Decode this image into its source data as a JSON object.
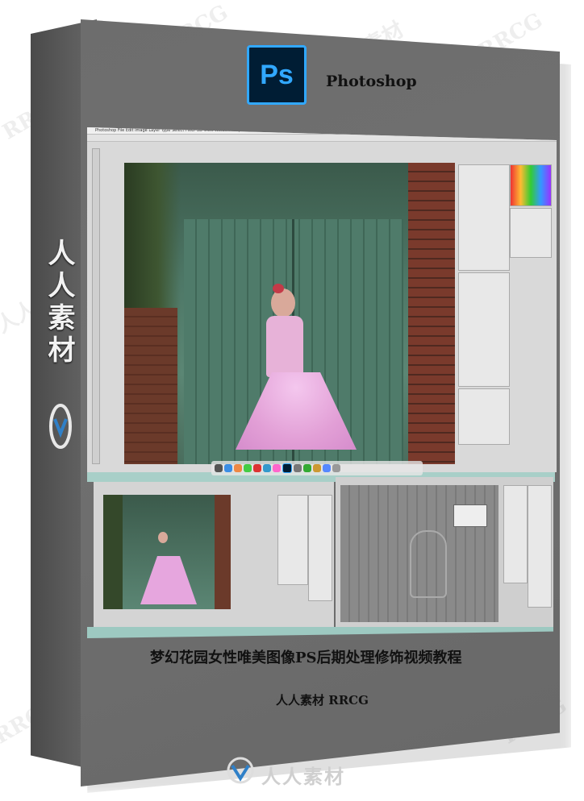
{
  "box": {
    "app_name": "Photoshop",
    "ps_logo_text": "Ps",
    "spine_text": "人人素材",
    "course_title": "梦幻花园女性唯美图像PS后期处理修饰视频教程",
    "brand_line": "人人素材 RRCG"
  },
  "watermark": {
    "site_cn": "人人素材",
    "site_en": "RRCG"
  },
  "screenshot": {
    "menu_items": "Photoshop  File  Edit  Image  Layer  Type  Select  Filter  3D  View  Window  Help"
  },
  "colors": {
    "box_gray": "#707070",
    "ps_blue": "#31a8ff",
    "ps_bg": "#001d34",
    "band_teal": "#a8cfc8"
  },
  "icons": [
    "ps-logo-icon",
    "rrcg-logo-icon"
  ]
}
